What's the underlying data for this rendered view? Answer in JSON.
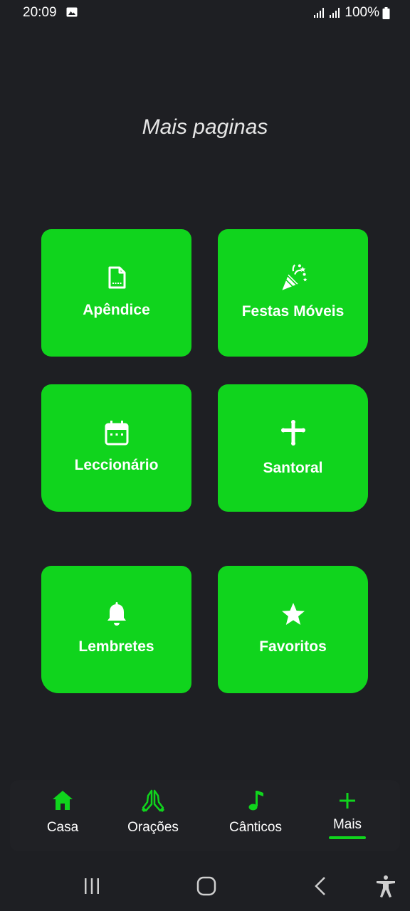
{
  "status_bar": {
    "time": "20:09",
    "battery_text": "100%",
    "icons": [
      "image-notification-icon",
      "signal-icon",
      "signal-icon",
      "battery-icon"
    ]
  },
  "page": {
    "title": "Mais paginas"
  },
  "tiles": [
    {
      "label": "Apêndice",
      "icon": "document-icon"
    },
    {
      "label": "Festas Móveis",
      "icon": "party-popper-icon"
    },
    {
      "label": "Leccionário",
      "icon": "calendar-icon"
    },
    {
      "label": "Santoral",
      "icon": "cross-icon"
    },
    {
      "label": "Lembretes",
      "icon": "bell-icon"
    },
    {
      "label": "Favoritos",
      "icon": "star-icon"
    }
  ],
  "bottom_nav": {
    "items": [
      {
        "label": "Casa",
        "icon": "home-icon"
      },
      {
        "label": "Orações",
        "icon": "praying-hands-icon"
      },
      {
        "label": "Cânticos",
        "icon": "music-note-icon"
      },
      {
        "label": "Mais",
        "icon": "plus-icon",
        "selected": true
      }
    ]
  },
  "colors": {
    "background": "#1e1f23",
    "accent": "#10d41d",
    "nav_background": "#202125"
  }
}
